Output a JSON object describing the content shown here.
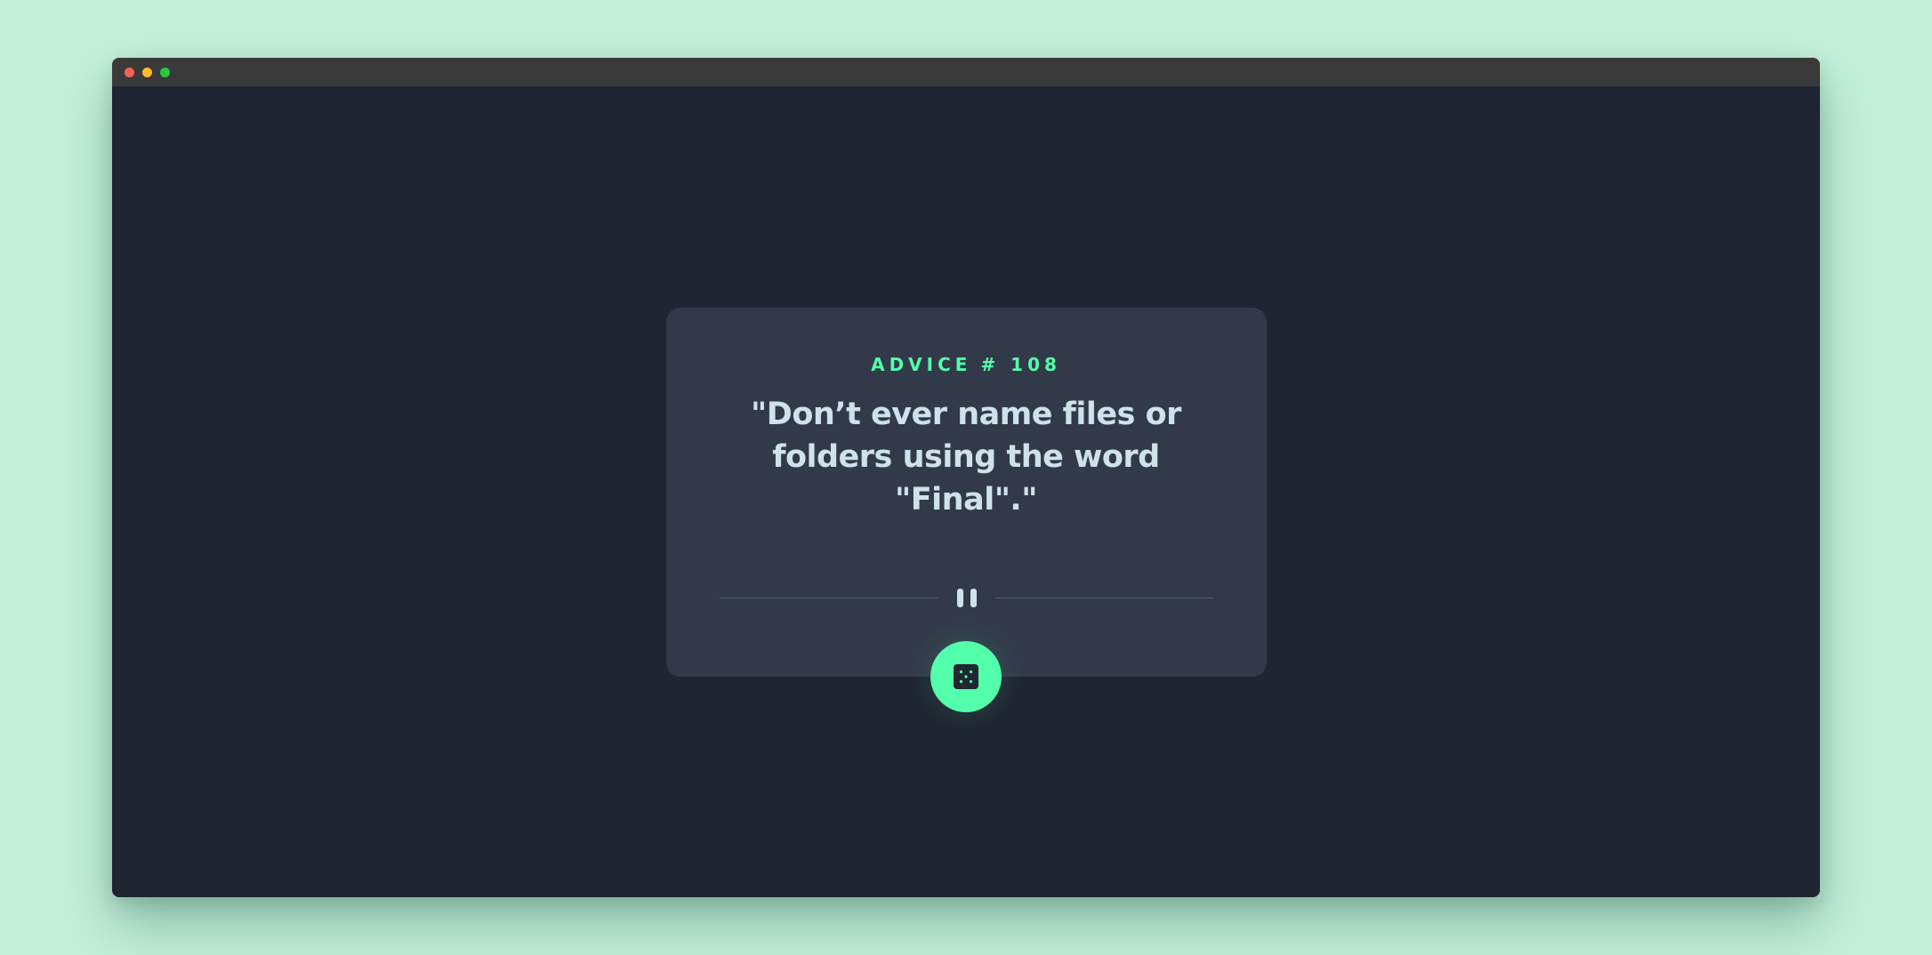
{
  "window": {
    "controls": [
      "close",
      "minimize",
      "maximize"
    ]
  },
  "advice": {
    "label": "ADVICE",
    "number": "# 108",
    "text": "\"Don’t ever name files or folders using the word \"Final\".\""
  },
  "icons": {
    "divider": "pause-icon",
    "button": "dice-icon"
  },
  "colors": {
    "page_background": "#c4f0da",
    "app_background": "#1f2632",
    "card": "#323a49",
    "accent": "#53ffaa",
    "text": "#cee3e9",
    "divider": "#4f5d74"
  }
}
